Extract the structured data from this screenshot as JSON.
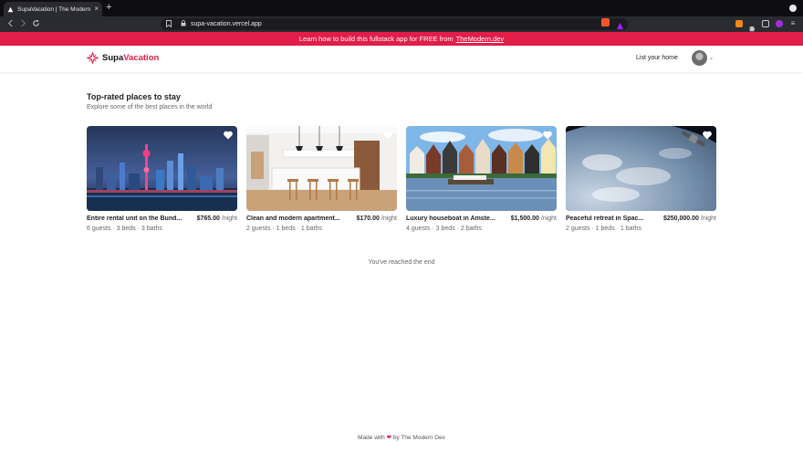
{
  "browser": {
    "tab_title": "SupaVacation | The Modern Dev",
    "new_tab": "+",
    "tab_close": "×",
    "url": "supa-vacation.vercel.app"
  },
  "announcement": {
    "text": "Learn how to build this fullstack app for FREE from",
    "link": "TheModern.dev"
  },
  "header": {
    "logo_part1": "Supa",
    "logo_part2": "Vacation",
    "list_home": "List your home",
    "caret": "⌄"
  },
  "main": {
    "title": "Top-rated places to stay",
    "subtitle": "Explore some of the best places in the world",
    "end_text": "You've reached the end"
  },
  "listings": [
    {
      "name": "Entire rental unit on the Bund...",
      "price": "$765.00",
      "per": "/night",
      "meta": "6 guests · 3 beds · 3 baths"
    },
    {
      "name": "Clean and modern apartment...",
      "price": "$170.00",
      "per": "/night",
      "meta": "2 guests · 1 beds · 1 baths"
    },
    {
      "name": "Luxury houseboat in Amste...",
      "price": "$1,500.00",
      "per": "/night",
      "meta": "4 guests · 3 beds · 2 baths"
    },
    {
      "name": "Peaceful retreat in Spac...",
      "price": "$250,000.00",
      "per": "/night",
      "meta": "2 guests · 1 beds · 1 baths"
    }
  ],
  "footer": {
    "made_with": "Made with",
    "heart": "❤",
    "by": "by The Modern Dev"
  },
  "colors": {
    "accent": "#e11d48"
  }
}
